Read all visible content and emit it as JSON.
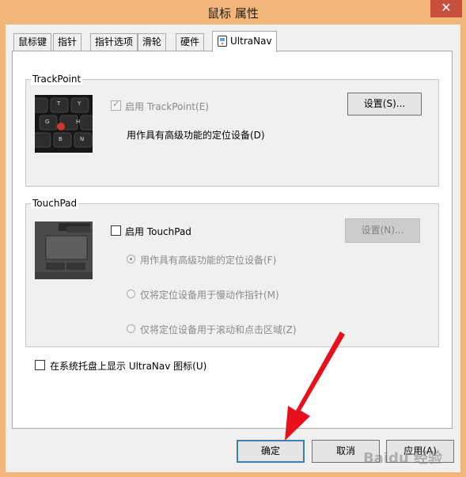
{
  "window": {
    "title": "鼠标 属性",
    "close_glyph": "✕"
  },
  "tabs": [
    {
      "label": "鼠标键"
    },
    {
      "label": "指针"
    },
    {
      "label": "指针选项"
    },
    {
      "label": "滑轮"
    },
    {
      "label": "硬件"
    },
    {
      "label": "UltraNav",
      "active": true
    }
  ],
  "trackpoint": {
    "group_label": "TrackPoint",
    "enable_label": "启用 TrackPoint(E)",
    "enable_checked": true,
    "settings_button": "设置(S)...",
    "description": "用作具有高级功能的定位设备(D)"
  },
  "touchpad": {
    "group_label": "TouchPad",
    "enable_label": "启用 TouchPad",
    "enable_checked": false,
    "settings_button": "设置(N)...",
    "options": [
      {
        "label": "用作具有高级功能的定位设备(F)",
        "selected": true
      },
      {
        "label": "仅将定位设备用于慢动作指针(M)",
        "selected": false
      },
      {
        "label": "仅将定位设备用于滚动和点击区域(Z)",
        "selected": false
      }
    ]
  },
  "tray_icon": {
    "label": "在系统托盘上显示 UltraNav 图标(U)",
    "checked": false
  },
  "footer": {
    "ok": "确定",
    "cancel": "取消",
    "apply": "应用(A)"
  },
  "watermark": "Baidu 经验",
  "colors": {
    "frame": "#f3b67a",
    "close": "#c7503d",
    "focus_border": "#3c7fb1",
    "arrow": "#e8101a"
  }
}
